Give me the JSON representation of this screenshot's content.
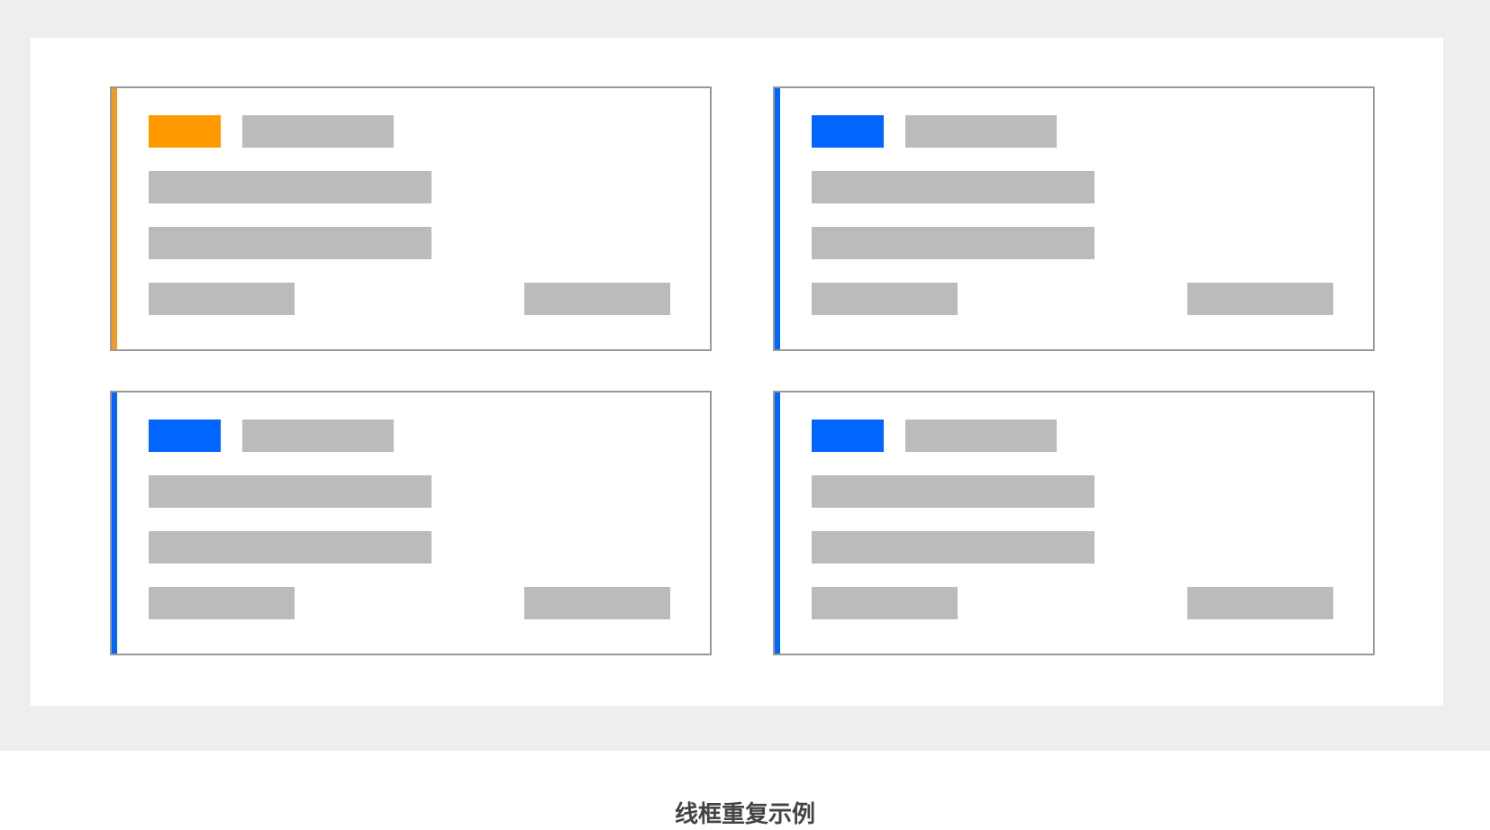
{
  "caption": "线框重复示例",
  "colors": {
    "stage_background": "#eeeeee",
    "canvas_background": "#ffffff",
    "card_border": "#999999",
    "placeholder": "#bbbbbb",
    "caption_text": "#444444"
  },
  "cards": [
    {
      "accent_color": "#f29c1f",
      "tag_color": "#ff9900"
    },
    {
      "accent_color": "#0066ff",
      "tag_color": "#0066ff"
    },
    {
      "accent_color": "#0066ff",
      "tag_color": "#0066ff"
    },
    {
      "accent_color": "#0066ff",
      "tag_color": "#0066ff"
    }
  ]
}
